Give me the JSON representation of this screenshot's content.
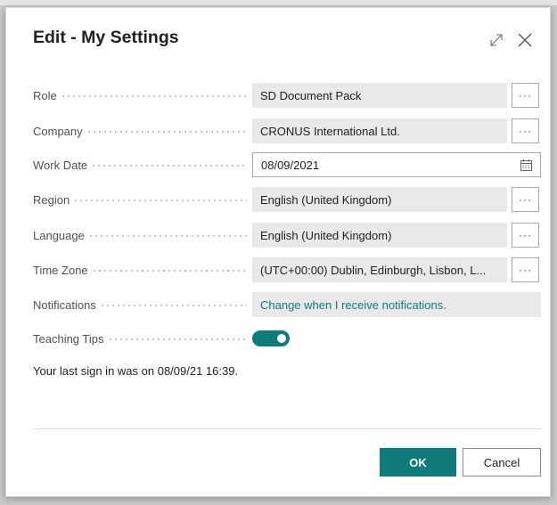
{
  "dialog": {
    "title": "Edit - My Settings",
    "expand_icon": "expand-icon",
    "close_icon": "close-icon"
  },
  "fields": {
    "role": {
      "label": "Role",
      "value": "SD Document Pack",
      "button": "···"
    },
    "company": {
      "label": "Company",
      "value": "CRONUS International Ltd.",
      "button": "···"
    },
    "work_date": {
      "label": "Work Date",
      "value": "08/09/2021",
      "icon": "calendar-icon"
    },
    "region": {
      "label": "Region",
      "value": "English (United Kingdom)",
      "button": "···"
    },
    "language": {
      "label": "Language",
      "value": "English (United Kingdom)",
      "button": "···"
    },
    "time_zone": {
      "label": "Time Zone",
      "value": "(UTC+00:00) Dublin, Edinburgh, Lisbon, L...",
      "button": "···"
    },
    "notifications": {
      "label": "Notifications",
      "value": "Change when I receive notifications."
    },
    "teaching_tips": {
      "label": "Teaching Tips",
      "enabled": true
    }
  },
  "last_sign_in": "Your last sign in was on 08/09/21 16:39.",
  "buttons": {
    "ok": "OK",
    "cancel": "Cancel"
  },
  "colors": {
    "accent": "#0f7b7b",
    "field_bg": "#e9e9e9",
    "link": "#0f7b7b"
  }
}
